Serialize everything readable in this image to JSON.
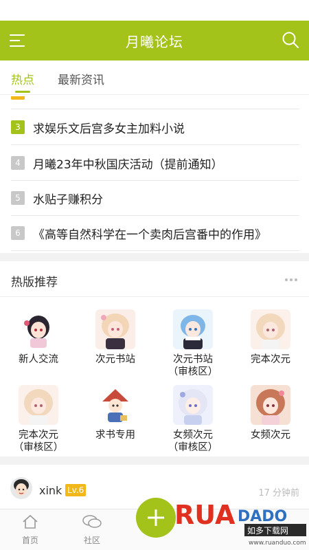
{
  "header": {
    "title": "月曦论坛",
    "menu_icon": "hamburger-menu-icon",
    "search_icon": "search-icon"
  },
  "tabs": [
    {
      "label": "热点"
    },
    {
      "label": "最新资讯"
    }
  ],
  "hot_list": [
    {
      "rank": "3",
      "title": "求娱乐文后宫多女主加料小说"
    },
    {
      "rank": "4",
      "title": "月曦23年中秋国庆活动（提前通知）"
    },
    {
      "rank": "5",
      "title": "水贴子赚积分"
    },
    {
      "rank": "6",
      "title": "《高等自然科学在一个卖肉后宫番中的作用》"
    }
  ],
  "recommend": {
    "title": "热版推荐",
    "boards": [
      {
        "line1": "新人交流",
        "line2": ""
      },
      {
        "line1": "次元书站",
        "line2": ""
      },
      {
        "line1": "次元书站",
        "line2": "（审核区）"
      },
      {
        "line1": "完本次元",
        "line2": ""
      },
      {
        "line1": "完本次元",
        "line2": "（审核区）"
      },
      {
        "line1": "求书专用",
        "line2": ""
      },
      {
        "line1": "女频次元",
        "line2": "（审核区）"
      },
      {
        "line1": "女频次元",
        "line2": ""
      }
    ]
  },
  "post": {
    "username": "xink",
    "level": "Lv.6",
    "time": "17 分钟前"
  },
  "bottom_nav": [
    {
      "label": "首页"
    },
    {
      "label": "社区"
    }
  ],
  "watermark": {
    "brand": "RUANDADO",
    "sub": "如多下载网",
    "url": "www.ruanduo.com"
  },
  "colors": {
    "accent": "#a3c21a",
    "badge_orange": "#f2b81a",
    "rank_gray": "#c8c8c8"
  }
}
